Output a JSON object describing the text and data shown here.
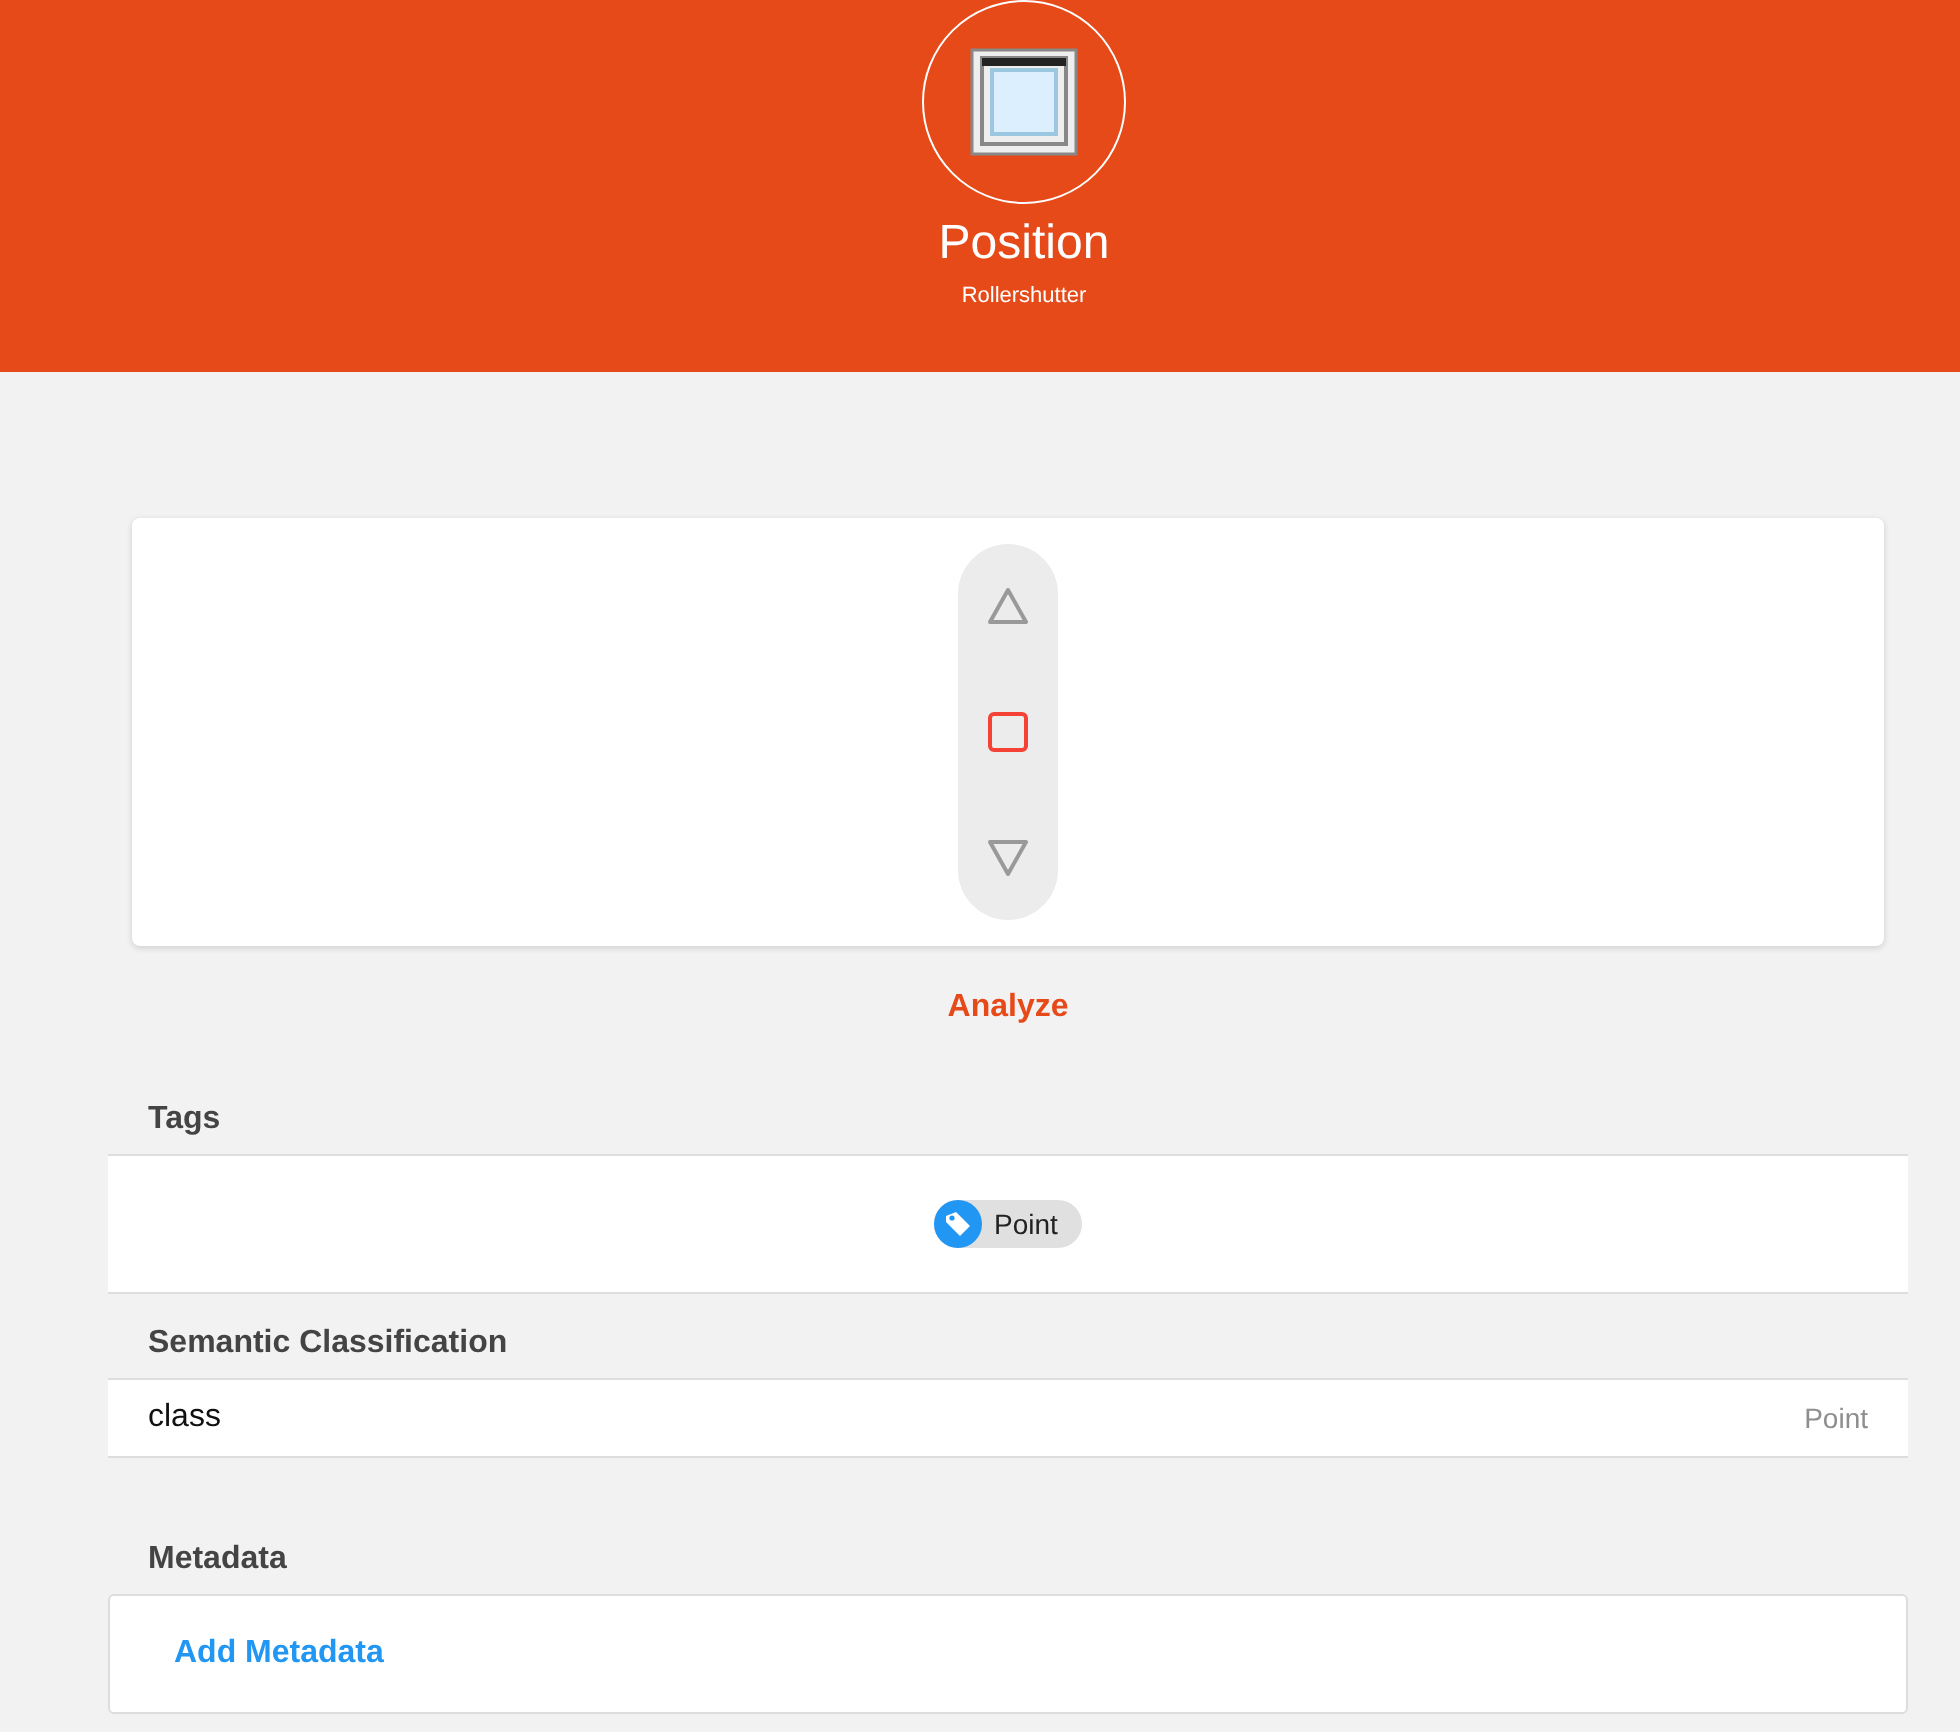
{
  "header": {
    "title": "Position",
    "subtitle": "Rollershutter"
  },
  "controls": [
    {
      "kind": "up"
    },
    {
      "kind": "stop"
    },
    {
      "kind": "down"
    }
  ],
  "analyze": "Analyze",
  "tags": {
    "heading": "Tags",
    "items": [
      "Point"
    ]
  },
  "semantic": {
    "heading": "Semantic Classification",
    "rows": [
      {
        "key": "class",
        "value": "Point"
      }
    ]
  },
  "metadata": {
    "heading": "Metadata",
    "action": "Add Metadata"
  }
}
